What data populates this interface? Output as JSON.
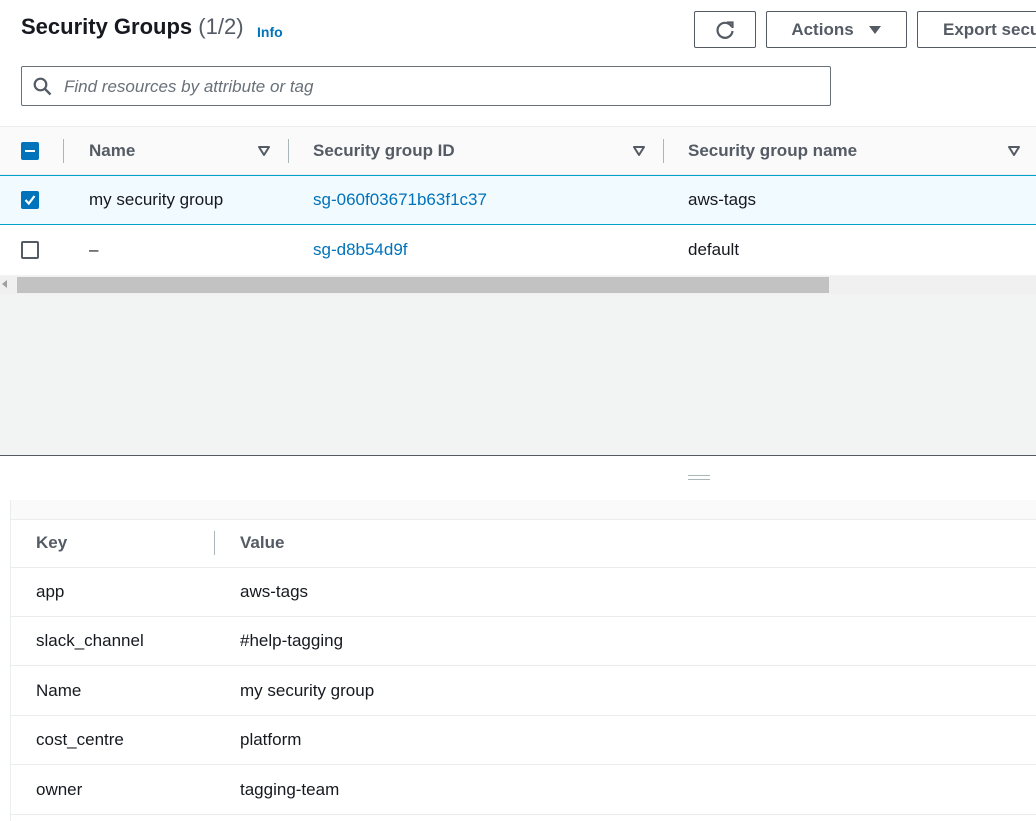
{
  "header": {
    "title": "Security Groups",
    "count": "(1/2)",
    "info_label": "Info",
    "actions_label": "Actions",
    "export_label": "Export secu"
  },
  "search": {
    "placeholder": "Find resources by attribute or tag"
  },
  "table": {
    "columns": [
      "Name",
      "Security group ID",
      "Security group name"
    ],
    "rows": [
      {
        "name": "my security group",
        "group_id": "sg-060f03671b63f1c37",
        "group_name": "aws-tags",
        "selected": true
      },
      {
        "name": "–",
        "group_id": "sg-d8b54d9f",
        "group_name": "default",
        "selected": false
      }
    ]
  },
  "tags": {
    "columns": [
      "Key",
      "Value"
    ],
    "rows": [
      {
        "key": "app",
        "value": "aws-tags"
      },
      {
        "key": "slack_channel",
        "value": "#help-tagging"
      },
      {
        "key": "Name",
        "value": "my security group"
      },
      {
        "key": "cost_centre",
        "value": "platform"
      },
      {
        "key": "owner",
        "value": "tagging-team"
      }
    ]
  },
  "colors": {
    "link": "#0073bb",
    "selected_row_bg": "#f1faff",
    "selected_row_border": "#00a1c9",
    "text_primary": "#16191f",
    "text_secondary": "#545b64"
  },
  "icons": {
    "refresh": "refresh-icon",
    "actions_caret": "caret-down-icon",
    "search": "search-icon",
    "sort": "sort-triangle-icon"
  }
}
